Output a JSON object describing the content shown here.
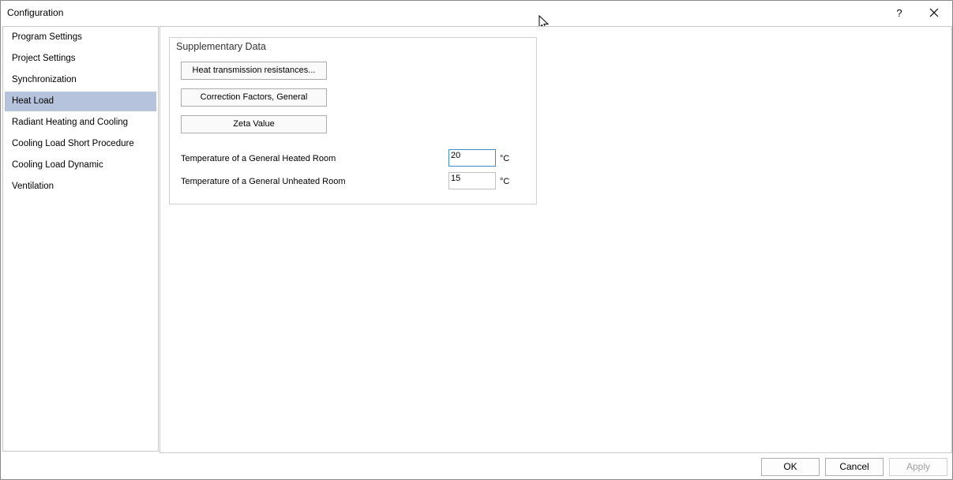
{
  "window": {
    "title": "Configuration",
    "help_label": "?"
  },
  "sidebar": {
    "selected_index": 3,
    "items": [
      {
        "label": "Program Settings"
      },
      {
        "label": "Project Settings"
      },
      {
        "label": "Synchronization"
      },
      {
        "label": "Heat Load"
      },
      {
        "label": "Radiant Heating and Cooling"
      },
      {
        "label": "Cooling Load Short Procedure"
      },
      {
        "label": "Cooling Load Dynamic"
      },
      {
        "label": "Ventilation"
      }
    ]
  },
  "supplementary": {
    "title": "Supplementary Data",
    "buttons": [
      {
        "label": "Heat transmission resistances..."
      },
      {
        "label": "Correction Factors, General"
      },
      {
        "label": "Zeta Value"
      }
    ],
    "heated_room": {
      "label": "Temperature of a General Heated Room",
      "value": "20",
      "unit": "°C"
    },
    "unheated_room": {
      "label": "Temperature of a General Unheated Room",
      "value": "15",
      "unit": "°C"
    }
  },
  "footer": {
    "ok_label": "OK",
    "cancel_label": "Cancel",
    "apply_label": "Apply",
    "apply_enabled": false
  },
  "colors": {
    "selection": "#b5c3dc",
    "focus_border": "#3e8ec8",
    "disabled_text": "#a0a0a0"
  }
}
